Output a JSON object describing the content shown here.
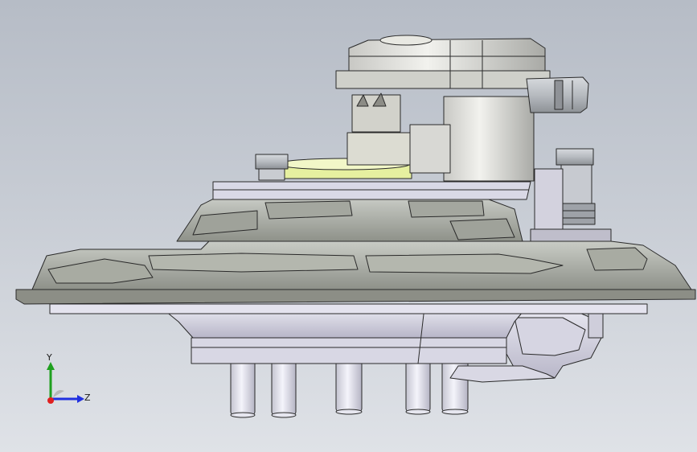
{
  "view": {
    "background_top": "#b6bcc6",
    "background_bottom": "#dfe2e7"
  },
  "model": {
    "body_color": "#c4c8cc",
    "highlight_color": "#e6f0a0",
    "edge_color": "#2a2a2a"
  },
  "triad": {
    "y_label": "Y",
    "z_label": "Z",
    "y_color": "#1fa01f",
    "z_color": "#2030e0",
    "x_color": "#e02020"
  }
}
